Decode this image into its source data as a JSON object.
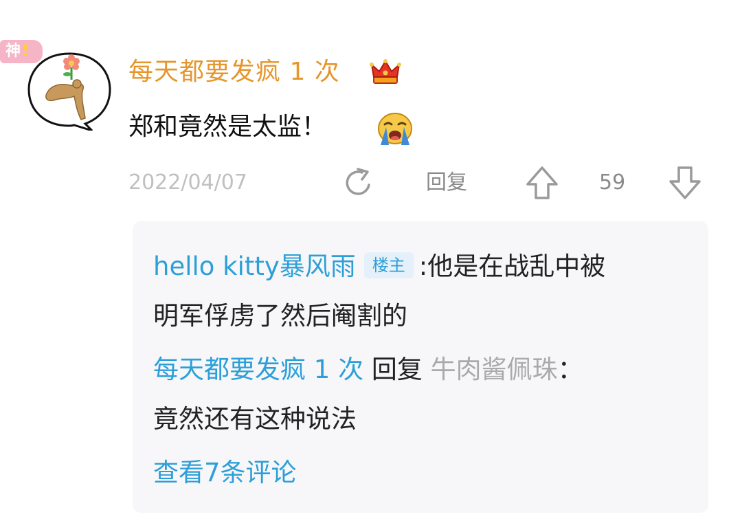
{
  "comment": {
    "badge": "神",
    "badge_mark": "!",
    "username": "每天都要发疯 1 次",
    "crown_icon": "crown-icon",
    "text": "郑和竟然是太监！",
    "emoji": "crying-face-emoji",
    "date": "2022/04/07",
    "reply_label": "回复",
    "vote_count": "59"
  },
  "replies": {
    "reply1": {
      "author": "hello kitty暴风雨",
      "op_badge": "楼主",
      "separator": ":",
      "text_line1": "他是在战乱中被",
      "text_line2": "明军俘虏了然后阉割的"
    },
    "reply2": {
      "author": "每天都要发疯 1 次",
      "reply_word": "回复",
      "target": "牛肉酱佩珠",
      "separator": "：",
      "text_line2": "竟然还有这种说法"
    },
    "view_more": "查看7条评论"
  },
  "colors": {
    "username": "#e5962c",
    "link_blue": "#2d9fd8",
    "muted": "#8a8a8a",
    "date": "#c0c0c0",
    "panel_bg": "#f7f7f9"
  }
}
